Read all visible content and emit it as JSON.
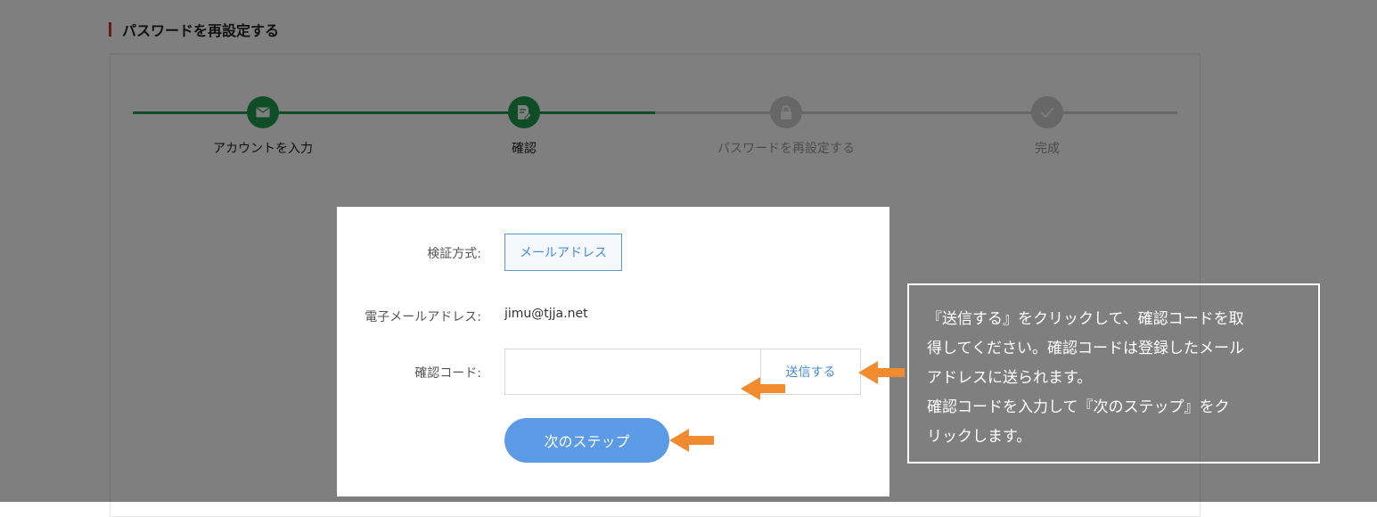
{
  "page": {
    "title": "パスワードを再設定する"
  },
  "steps": [
    {
      "label": "アカウントを入力",
      "icon": "envelope-icon",
      "state": "done"
    },
    {
      "label": "確認",
      "icon": "edit-document-icon",
      "state": "active"
    },
    {
      "label": "パスワードを再設定する",
      "icon": "lock-icon",
      "state": "pending"
    },
    {
      "label": "完成",
      "icon": "check-icon",
      "state": "pending"
    }
  ],
  "colors": {
    "accent_green": "#1f9b4f",
    "accent_blue": "#5b9be6",
    "pending_gray": "#cfcfcf",
    "arrow_orange": "#f28a2e"
  },
  "form": {
    "method_label": "検証方式:",
    "method_value": "メールアドレス",
    "email_label": "電子メールアドレス:",
    "email_value": "jimu@tjja.net",
    "code_label": "確認コード:",
    "code_value": "",
    "send_button": "送信する",
    "next_button": "次のステップ"
  },
  "tip": {
    "lines": [
      "『送信する』をクリックして、確認コードを取",
      "得してください。確認コードは登録したメール",
      "アドレスに送られます。",
      "確認コードを入力して『次のステップ』をク",
      "リックします。"
    ]
  }
}
